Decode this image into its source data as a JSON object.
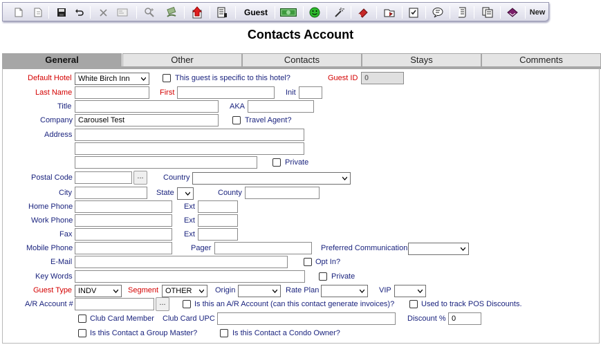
{
  "toolbar": {
    "guest_label": "Guest",
    "new_label": "New",
    "icons": [
      "new-doc-icon",
      "copy-doc-icon",
      "save-icon",
      "undo-icon",
      "delete-icon",
      "card-icon",
      "search-icon",
      "hand-money-icon",
      "upload-icon",
      "report-icon",
      "money-icon",
      "smiley-icon",
      "magic-wand-icon",
      "eraser-icon",
      "folder-icon",
      "checklist-icon",
      "comment-icon",
      "scroll-icon",
      "documents-icon",
      "book-icon"
    ]
  },
  "page": {
    "title": "Contacts Account"
  },
  "tabs": [
    "General",
    "Other",
    "Contacts",
    "Stays",
    "Comments"
  ],
  "form": {
    "default_hotel_label": "Default Hotel",
    "default_hotel_value": "White Birch Inn",
    "specific_hotel_label": "This guest is specific to this hotel?",
    "guest_id_label": "Guest ID",
    "guest_id_value": "0",
    "last_name_label": "Last Name",
    "first_label": "First",
    "init_label": "Init",
    "title_label": "Title",
    "aka_label": "AKA",
    "company_label": "Company",
    "company_value": "Carousel Test",
    "travel_agent_label": "Travel Agent?",
    "address_label": "Address",
    "private_label": "Private",
    "postal_code_label": "Postal Code",
    "ellipsis": "...",
    "country_label": "Country",
    "city_label": "City",
    "state_label": "State",
    "county_label": "County",
    "home_phone_label": "Home Phone",
    "ext_label": "Ext",
    "work_phone_label": "Work Phone",
    "fax_label": "Fax",
    "mobile_phone_label": "Mobile Phone",
    "pager_label": "Pager",
    "preferred_comm_label": "Preferred Communication",
    "email_label": "E-Mail",
    "opt_in_label": "Opt In?",
    "key_words_label": "Key Words",
    "guest_type_label": "Guest Type",
    "guest_type_value": "INDV",
    "segment_label": "Segment",
    "segment_value": "OTHER",
    "origin_label": "Origin",
    "rate_plan_label": "Rate Plan",
    "vip_label": "VIP",
    "ar_account_label": "A/R Account #",
    "ar_question_label": "Is this an A/R Account (can this contact generate invoices)?",
    "pos_discount_label": "Used to track POS Discounts.",
    "club_card_member_label": "Club Card Member",
    "club_card_upc_label": "Club Card UPC",
    "discount_label": "Discount %",
    "discount_value": "0",
    "group_master_label": "Is this Contact a Group Master?",
    "condo_owner_label": "Is this Contact a Condo Owner?"
  },
  "colors": {
    "required_label": "#d40000",
    "label": "#1a237e",
    "active_tab": "#a6a6a6"
  }
}
